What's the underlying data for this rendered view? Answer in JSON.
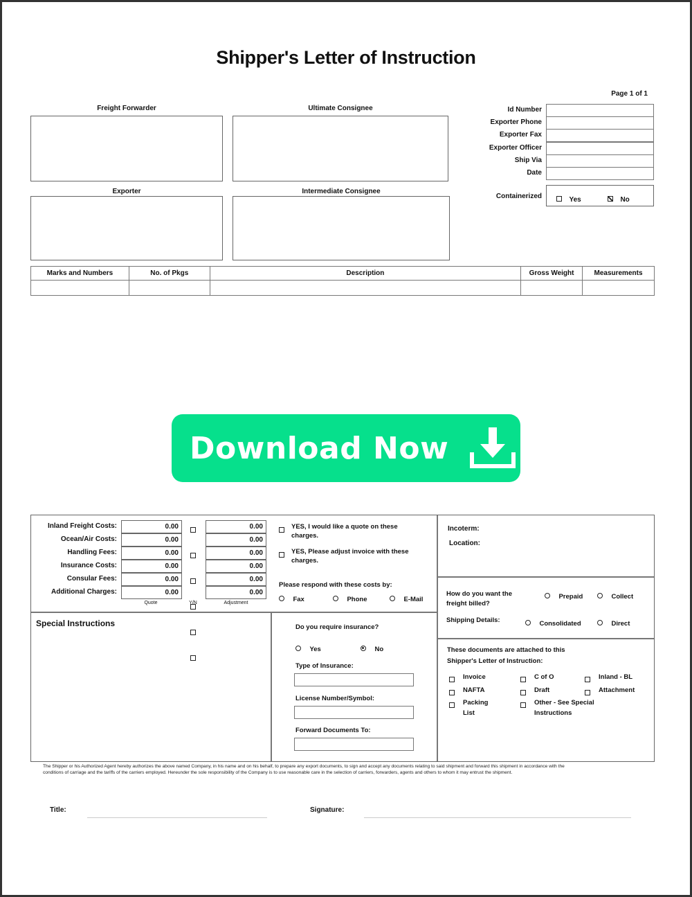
{
  "document": {
    "title": "Shipper's Letter of Instruction",
    "page_indicator": "Page 1 of 1"
  },
  "parties": {
    "freight_forwarder": "Freight Forwarder",
    "ultimate_consignee": "Ultimate Consignee",
    "exporter": "Exporter",
    "intermediate_consignee": "Intermediate Consignee"
  },
  "right_fields": [
    {
      "label": "Id Number",
      "value": ""
    },
    {
      "label": "Exporter Phone",
      "value": ""
    },
    {
      "label": "Exporter Fax",
      "value": ""
    },
    {
      "label": "Exporter Officer",
      "value": ""
    },
    {
      "label": "Ship Via",
      "value": ""
    },
    {
      "label": "Date",
      "value": ""
    }
  ],
  "containerized": {
    "label": "Containerized",
    "options": [
      {
        "label": "Yes",
        "checked": false
      },
      {
        "label": "No",
        "checked": true
      }
    ]
  },
  "goods_table": {
    "columns": [
      "Marks and Numbers",
      "No. of Pkgs",
      "Description",
      "Gross Weight",
      "Measurements"
    ],
    "rows": [
      [
        "",
        "",
        "",
        "",
        ""
      ]
    ]
  },
  "download_button": {
    "label": "Download Now",
    "icon": "download-icon",
    "color": "#06e08c"
  },
  "fees": {
    "rows": [
      {
        "label": "Inland Freight Costs:",
        "quote": "0.00",
        "yn": false,
        "adjustment": "0.00"
      },
      {
        "label": "Ocean/Air Costs:",
        "quote": "0.00",
        "yn": false,
        "adjustment": "0.00"
      },
      {
        "label": "Handling Fees:",
        "quote": "0.00",
        "yn": false,
        "adjustment": "0.00"
      },
      {
        "label": "Insurance Costs:",
        "quote": "0.00",
        "yn": false,
        "adjustment": "0.00"
      },
      {
        "label": "Consular Fees:",
        "quote": "0.00",
        "yn": false,
        "adjustment": "0.00"
      },
      {
        "label": "Additional Charges:",
        "quote": "0.00",
        "yn": false,
        "adjustment": "0.00"
      }
    ],
    "captions": {
      "quote": "Quote",
      "yn": "Y/N",
      "adjustment": "Adjustment"
    }
  },
  "quote_options": {
    "quote_request": "YES, I would like a quote on these charges.",
    "adjust_invoice": "YES, Please adjust invoice with these charges.",
    "respond_label": "Please respond with these costs by:",
    "respond_options": [
      "Fax",
      "Phone",
      "E-Mail"
    ]
  },
  "terms": {
    "incoterm_label": "Incoterm:",
    "location_label": "Location:"
  },
  "billing": {
    "question": "How do you want the freight billed?",
    "options": [
      "Prepaid",
      "Collect"
    ],
    "shipping_label": "Shipping Details:",
    "shipping_options": [
      "Consolidated",
      "Direct"
    ]
  },
  "special_instructions": {
    "heading": "Special Instructions"
  },
  "insurance": {
    "question": "Do you require insurance?",
    "options": [
      {
        "label": "Yes",
        "selected": false
      },
      {
        "label": "No",
        "selected": true
      }
    ],
    "type_label": "Type of Insurance:",
    "license_label": "License Number/Symbol:",
    "forward_label": "Forward Documents To:"
  },
  "attachments": {
    "heading_line1": "These documents are attached to this",
    "heading_line2": "Shipper's Letter of Instruction:",
    "items": [
      {
        "label": "Invoice",
        "checked": false
      },
      {
        "label": "C of O",
        "checked": false
      },
      {
        "label": "Inland - BL",
        "checked": false
      },
      {
        "label": "NAFTA",
        "checked": false
      },
      {
        "label": "Draft",
        "checked": false
      },
      {
        "label": "Attachment",
        "checked": false
      },
      {
        "label": "Packing List",
        "checked": false
      },
      {
        "label": "Other - See Special Instructions",
        "checked": false
      }
    ]
  },
  "legal_text": "The Shipper or his Authorized Agent hereby authorizes the above named Company, in his name and on his behalf, to prepare any export documents, to sign and accept any documents relating to said shipment and forward this shipment in accordance with the conditions of carriage and the tariffs of the carriers employed. Hereunder the sole responsibility of the Company is to use reasonable care in the selection of carriers, forwarders, agents and others to whom it may entrust the shipment.",
  "signature_block": {
    "title_label": "Title:",
    "signature_label": "Signature:"
  }
}
